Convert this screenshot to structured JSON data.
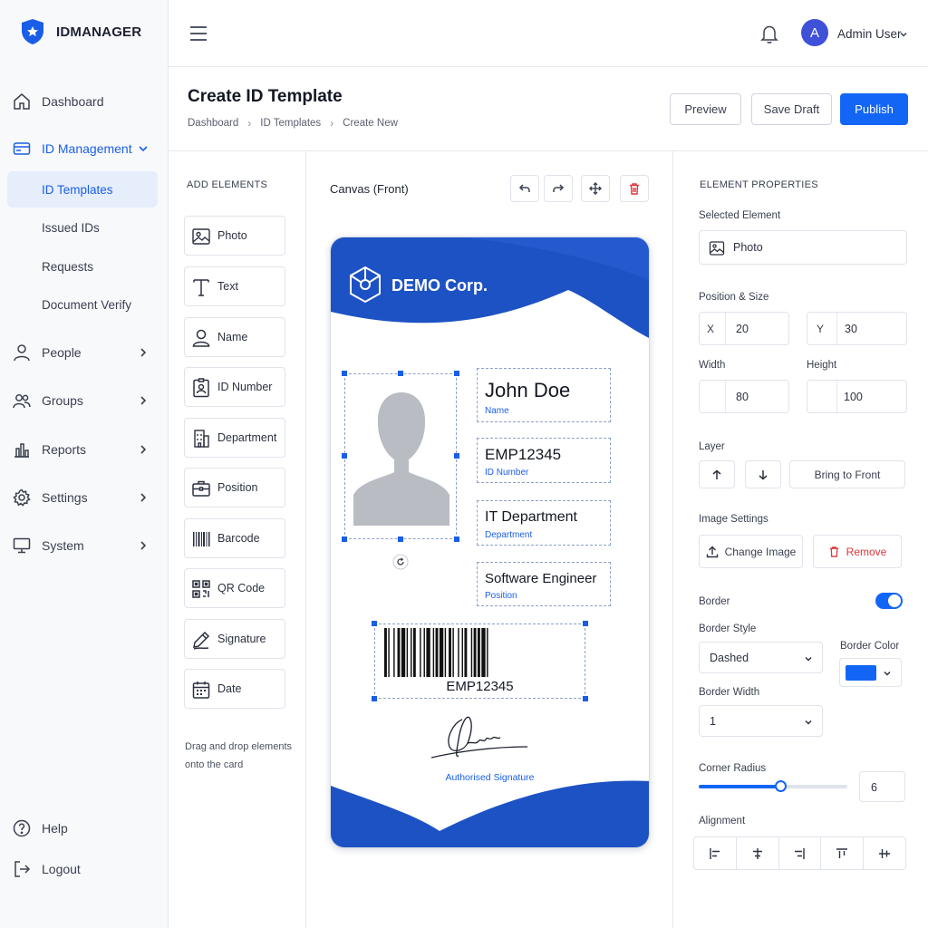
{
  "brand": {
    "name": "IDMANAGER"
  },
  "user": {
    "initial": "A",
    "name": "Admin User"
  },
  "sidebar": {
    "items": [
      {
        "label": "Dashboard"
      },
      {
        "label": "ID Management"
      },
      {
        "label": "People"
      },
      {
        "label": "Groups"
      },
      {
        "label": "Reports"
      },
      {
        "label": "Settings"
      },
      {
        "label": "System"
      }
    ],
    "sub_items": [
      {
        "label": "ID Templates"
      },
      {
        "label": "Issued IDs"
      },
      {
        "label": "Requests"
      },
      {
        "label": "Document Verify"
      }
    ],
    "footer": [
      {
        "label": "Help"
      },
      {
        "label": "Logout"
      }
    ]
  },
  "header": {
    "title": "Create ID Template",
    "breadcrumb": [
      "Dashboard",
      "ID Templates",
      "Create New"
    ],
    "buttons": {
      "preview": "Preview",
      "save_draft": "Save Draft",
      "publish": "Publish"
    }
  },
  "add_elements": {
    "caption": "ADD ELEMENTS",
    "items": [
      {
        "label": "Photo"
      },
      {
        "label": "Text"
      },
      {
        "label": "Name"
      },
      {
        "label": "ID Number"
      },
      {
        "label": "Department"
      },
      {
        "label": "Position"
      },
      {
        "label": "Barcode"
      },
      {
        "label": "QR Code"
      },
      {
        "label": "Signature"
      },
      {
        "label": "Date"
      }
    ],
    "hint": "Drag and drop elements onto the card"
  },
  "canvas": {
    "title": "Canvas (Front)",
    "card": {
      "company": "DEMO Corp.",
      "fields": [
        {
          "value": "John Doe",
          "caption": "Name"
        },
        {
          "value": "EMP12345",
          "caption": "ID Number"
        },
        {
          "value": "IT Department",
          "caption": "Department"
        },
        {
          "value": "Software Engineer",
          "caption": "Position"
        }
      ],
      "barcode_text": "EMP12345",
      "signature_caption": "Authorised Signature"
    }
  },
  "properties": {
    "caption": "ELEMENT PROPERTIES",
    "selected_label": "Selected Element",
    "selected_value": "Photo",
    "position_label": "Position & Size",
    "x_label": "X",
    "x_value": "20",
    "y_label": "Y",
    "y_value": "30",
    "width_label": "Width",
    "width_value": "80",
    "height_label": "Height",
    "height_value": "100",
    "layer_label": "Layer",
    "bring_front": "Bring to Front",
    "image_settings_label": "Image Settings",
    "change_image": "Change Image",
    "remove": "Remove",
    "border_label": "Border",
    "border_on": true,
    "border_style_label": "Border Style",
    "border_style_value": "Dashed",
    "border_color_label": "Border Color",
    "border_color_value": "#1366f5",
    "border_width_label": "Border Width",
    "border_width_value": "1",
    "corner_radius_label": "Corner Radius",
    "corner_radius_value": "6",
    "corner_radius_fraction": 0.55,
    "alignment_label": "Alignment"
  },
  "colors": {
    "accent": "#1366f5",
    "card_blue": "#1d52c4",
    "danger": "#e0363b"
  }
}
